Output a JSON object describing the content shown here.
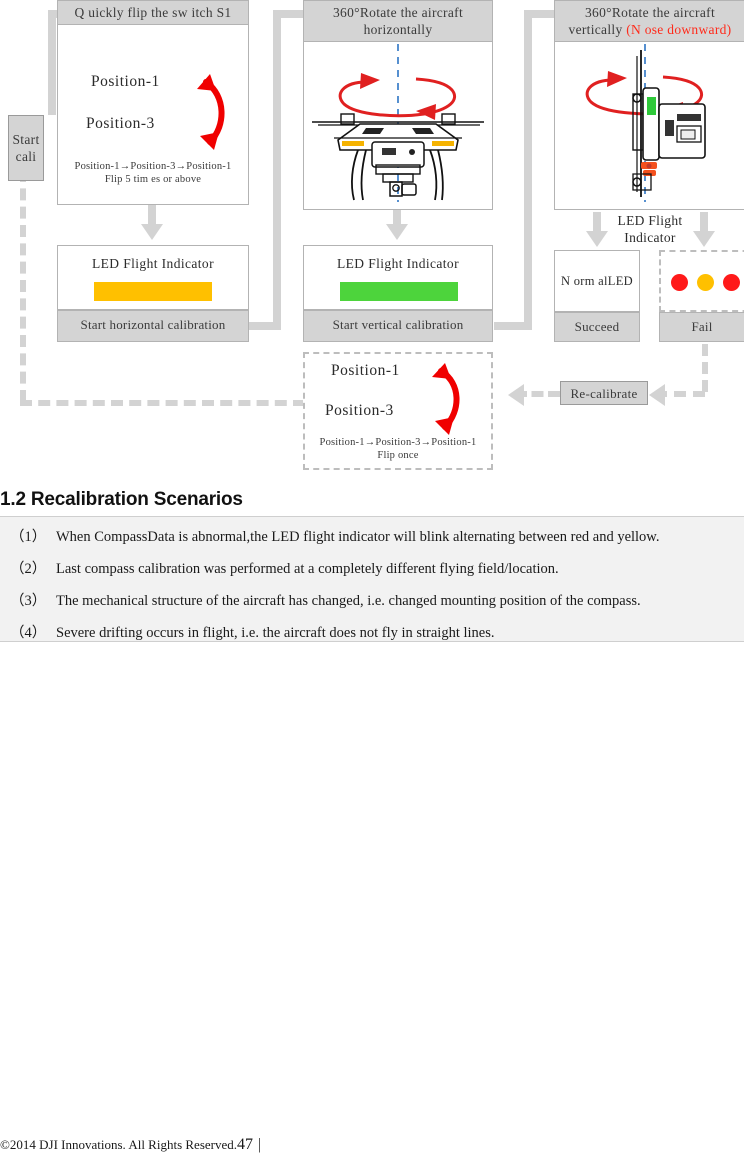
{
  "flowchart": {
    "start_node": {
      "label": "Start\ncali"
    },
    "step1": {
      "header": "Q uickly flip the sw itch S1",
      "position_a": "Position-1",
      "position_b": "Position-3",
      "note_line1": "Position-1→Position-3→Position-1",
      "note_line2": "Flip 5 tim es or above"
    },
    "step1_led": {
      "title": "LED Flight Indicator",
      "bar_color": "#FFC000",
      "footer": "Start horizontal calibration"
    },
    "step2": {
      "header_line1": "360°Rotate the aircraft",
      "header_line2": "horizontally"
    },
    "step2_led": {
      "title": "LED Flight Indicator",
      "bar_color": "#4DD43C",
      "footer": "Start vertical calibration"
    },
    "step3": {
      "header_line1": "360°Rotate the aircraft",
      "header_line2_black": "vertically ",
      "header_line2_red": "(N ose downward)"
    },
    "led_branch_label_line1": "LED Flight",
    "led_branch_label_line2": "Indicator",
    "succeed": {
      "body": "N orm alLED",
      "footer": "Succeed"
    },
    "fail": {
      "footer": "Fail",
      "dot_colors": [
        "#FF1A1A",
        "#FFC000",
        "#FF1A1A",
        "#FFC000"
      ]
    },
    "recalibrate": {
      "label": "Re-calibrate"
    },
    "recal_step": {
      "position_a": "Position-1",
      "position_b": "Position-3",
      "note_line1": "Position-1→Position-3→Position-1",
      "note_line2": "Flip once"
    }
  },
  "section": {
    "title": "1.2 Recalibration Scenarios",
    "items": [
      {
        "num": "（1）",
        "text": "When CompassData is abnormal,the LED flight indicator will blink alternating between red and yellow."
      },
      {
        "num": "（2）",
        "text": "Last compass calibration was performed at a completely different flying field/location."
      },
      {
        "num": "（3）",
        "text": "The mechanical structure of the aircraft has changed, i.e. changed mounting position of the compass."
      },
      {
        "num": "（4）",
        "text": "Severe drifting occurs in flight, i.e. the aircraft does not fly in straight lines."
      }
    ]
  },
  "footer": {
    "copyright": "©2014 DJI Innovations. All Rights Reserved.",
    "page_number": "47",
    "separator": "|"
  }
}
